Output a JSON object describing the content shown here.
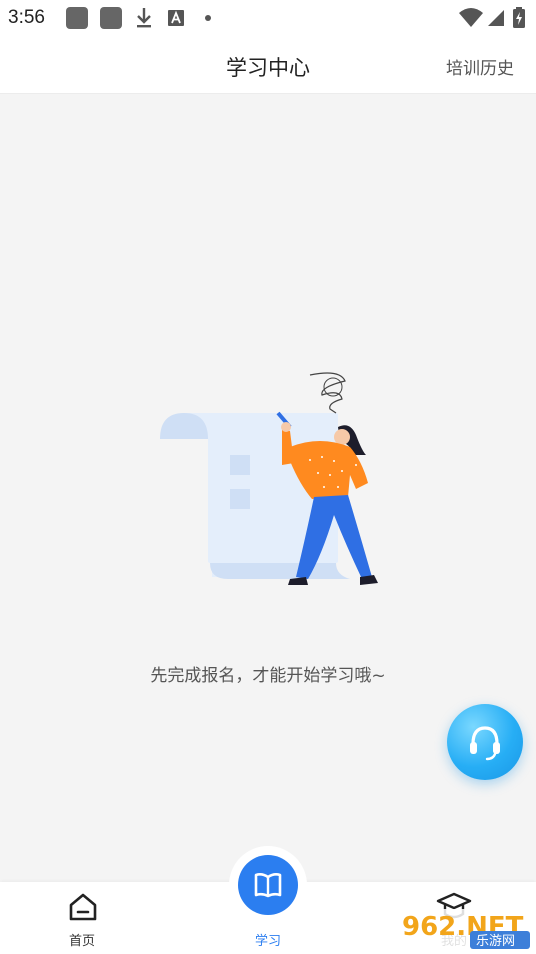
{
  "status_bar": {
    "time": "3:56"
  },
  "header": {
    "title": "学习中心",
    "history_label": "培训历史"
  },
  "main": {
    "empty_message": "先完成报名，才能开始学习哦~"
  },
  "bottom_nav": {
    "items": [
      {
        "label": "首页",
        "icon": "home-icon"
      },
      {
        "label": "学习",
        "icon": "book-icon",
        "active": true
      },
      {
        "label": "我的",
        "icon": "graduation-cap-icon"
      }
    ]
  },
  "watermark": {
    "text": "962.NET",
    "sub": "乐游网"
  },
  "colors": {
    "accent": "#2b7ef0",
    "fab": "#27aef5",
    "figure_shirt": "#ff8a1f",
    "figure_pants": "#2f6fe4"
  }
}
